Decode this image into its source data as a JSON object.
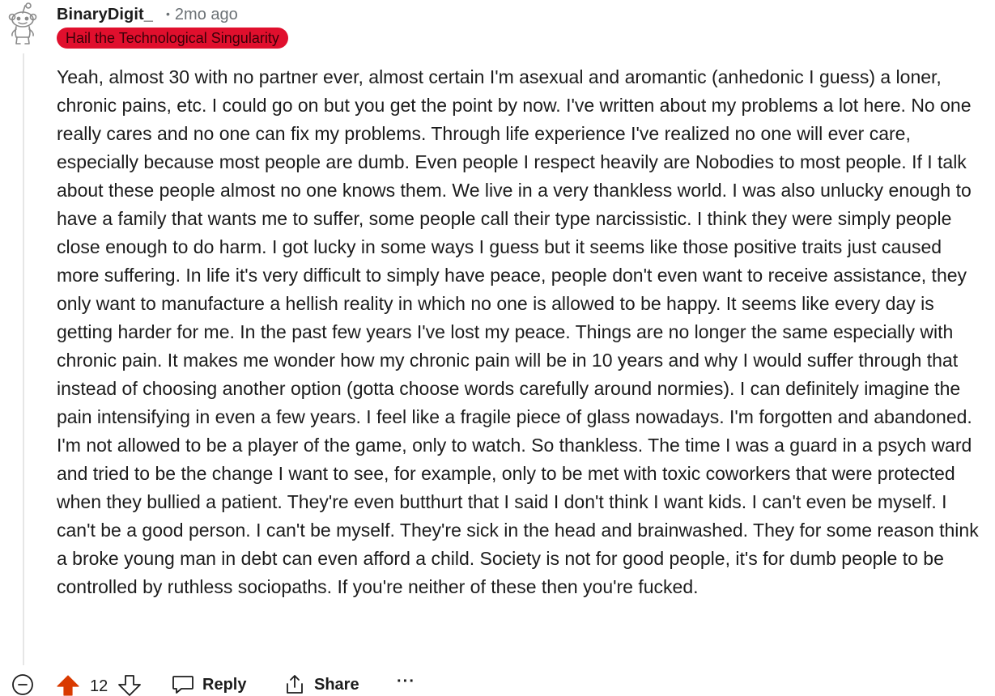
{
  "comment": {
    "author": "BinaryDigit_",
    "timestamp": "2mo ago",
    "flair": "Hail the Technological Singularity",
    "flair_color": "#e00f2d",
    "body": "Yeah, almost 30 with no partner ever, almost certain I'm asexual and aromantic (anhedonic I guess) a loner, chronic pains, etc. I could go on but you get the point by now. I've written about my problems a lot here. No one really cares and no one can fix my problems. Through life experience I've realized no one will ever care, especially because most people are dumb. Even people I respect heavily are Nobodies to most people. If I talk about these people almost no one knows them. We live in a very thankless world. I was also unlucky enough to have a family that wants me to suffer, some people call their type narcissistic. I think they were simply people close enough to do harm. I got lucky in some ways I guess but it seems like those positive traits just caused more suffering. In life it's very difficult to simply have peace, people don't even want to receive assistance, they only want to manufacture a hellish reality in which no one is allowed to be happy. It seems like every day is getting harder for me. In the past few years I've lost my peace. Things are no longer the same especially with chronic pain. It makes me wonder how my chronic pain will be in 10 years and why I would suffer through that instead of choosing another option (gotta choose words carefully around normies). I can definitely imagine the pain intensifying in even a few years. I feel like a fragile piece of glass nowadays. I'm forgotten and abandoned. I'm not allowed to be a player of the game, only to watch. So thankless. The time I was a guard in a psych ward and tried to be the change I want to see, for example, only to be met with toxic coworkers that were protected when they bullied a patient. They're even butthurt that I said I don't think I want kids. I can't even be myself. I can't be a good person. I can't be myself. They're sick in the head and brainwashed. They for some reason think a broke young man in debt can even afford a child. Society is not for good people, it's for dumb people to be controlled by ruthless sociopaths. If you're neither of these then you're fucked."
  },
  "actions": {
    "score": "12",
    "upvote_color": "#d93a00",
    "reply_label": "Reply",
    "share_label": "Share",
    "more_label": "···"
  },
  "icons": {
    "avatar": "snoo-avatar-icon",
    "collapse": "collapse-minus-icon",
    "upvote": "upvote-arrow-icon",
    "downvote": "downvote-arrow-icon",
    "reply": "comment-bubble-icon",
    "share": "share-icon",
    "more": "more-options-icon"
  }
}
